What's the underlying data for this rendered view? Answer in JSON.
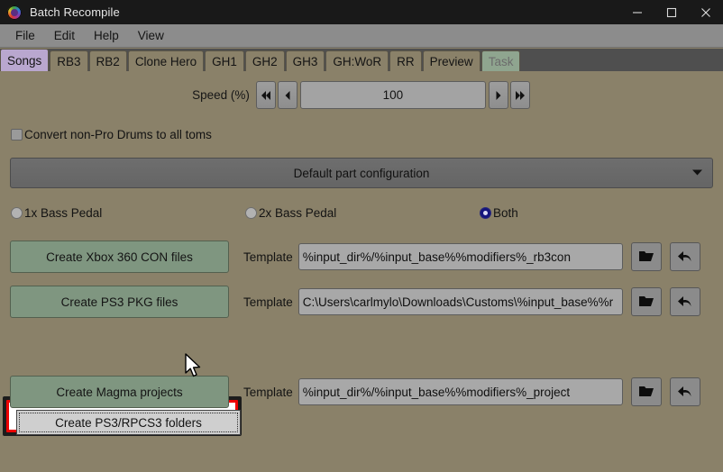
{
  "window": {
    "title": "Batch Recompile",
    "icon": "app-logo-icon",
    "controls": {
      "minimize": "minimize-icon",
      "maximize": "maximize-icon",
      "close": "close-icon"
    }
  },
  "menubar": {
    "items": [
      {
        "label": "File"
      },
      {
        "label": "Edit"
      },
      {
        "label": "Help"
      },
      {
        "label": "View"
      }
    ]
  },
  "tabs": {
    "items": [
      {
        "label": "Songs",
        "state": "selected"
      },
      {
        "label": "RB3",
        "state": "normal"
      },
      {
        "label": "RB2",
        "state": "normal"
      },
      {
        "label": "Clone Hero",
        "state": "normal"
      },
      {
        "label": "GH1",
        "state": "normal"
      },
      {
        "label": "GH2",
        "state": "normal"
      },
      {
        "label": "GH3",
        "state": "normal"
      },
      {
        "label": "GH:WoR",
        "state": "normal"
      },
      {
        "label": "RR",
        "state": "normal"
      },
      {
        "label": "Preview",
        "state": "normal"
      },
      {
        "label": "Task",
        "state": "disabled"
      }
    ],
    "selected_color": "#b9a7cf",
    "disabled_color": "#8fa58f"
  },
  "speed": {
    "label": "Speed (%)",
    "value": "100",
    "first_button": "double-left-arrow-icon",
    "prev_button": "left-arrow-icon",
    "next_button": "right-arrow-icon",
    "last_button": "double-right-arrow-icon"
  },
  "drums_checkbox": {
    "label": "Convert non-Pro Drums to all toms",
    "checked": false
  },
  "part_config": {
    "value": "Default part configuration",
    "arrow": "chevron-down-icon"
  },
  "bass_pedal": {
    "options": [
      {
        "label": "1x Bass Pedal",
        "selected": false
      },
      {
        "label": "2x Bass Pedal",
        "selected": false
      },
      {
        "label": "Both",
        "selected": true
      }
    ],
    "selected_color": "#15157d"
  },
  "actions": {
    "template_label": "Template",
    "browse_icon": "folder-icon",
    "reset_icon": "undo-arrow-icon",
    "rows": [
      {
        "button_label": "Create Xbox 360 CON files",
        "template_value": "%input_dir%/%input_base%%modifiers%_rb3con",
        "has_template": true
      },
      {
        "button_label": "Create PS3 PKG files",
        "template_value": "C:\\Users\\carlmylo\\Downloads\\Customs\\%input_base%%r",
        "has_template": true
      },
      {
        "button_label": "Create PS3/RPCS3 folders",
        "template_value": "",
        "has_template": false
      },
      {
        "button_label": "Create Magma projects",
        "template_value": "%input_dir%/%input_base%%modifiers%_project",
        "has_template": true
      }
    ],
    "highlight_color": "#ee0000",
    "button_color": "#7f9680"
  }
}
